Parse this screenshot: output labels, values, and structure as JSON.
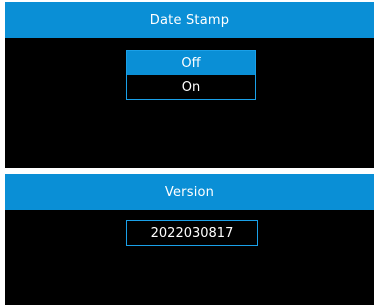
{
  "colors": {
    "accent": "#0a8fd6",
    "border": "#1aa0e8",
    "panel_bg": "#000000",
    "text": "#ffffff"
  },
  "date_stamp_screen": {
    "title": "Date Stamp",
    "options": [
      {
        "label": "Off",
        "selected": true
      },
      {
        "label": "On",
        "selected": false
      }
    ]
  },
  "version_screen": {
    "title": "Version",
    "value": "2022030817"
  }
}
